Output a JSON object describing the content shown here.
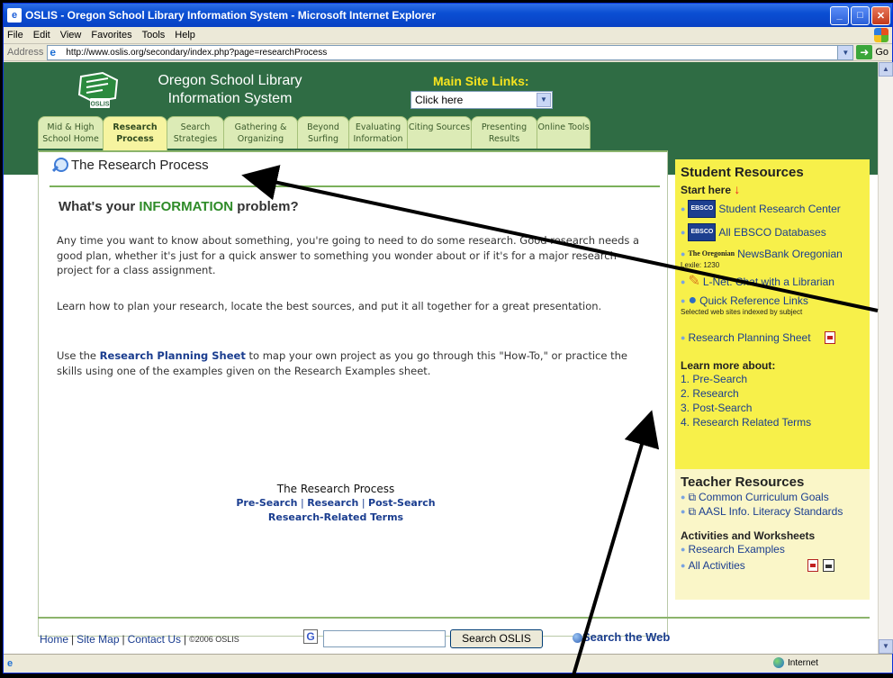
{
  "window": {
    "title": "OSLIS - Oregon School Library Information System - Microsoft Internet Explorer",
    "menus": [
      "File",
      "Edit",
      "View",
      "Favorites",
      "Tools",
      "Help"
    ],
    "address_label": "Address",
    "url": "http://www.oslis.org/secondary/index.php?page=researchProcess",
    "go_label": "Go"
  },
  "site": {
    "logo_text": "OSLIS",
    "title": "Oregon School Library Information System",
    "main_links_title": "Main Site Links:",
    "main_links_select": "Click here"
  },
  "tabs": [
    {
      "label": "Mid & High School Home",
      "active": false
    },
    {
      "label": "Research Process",
      "active": true
    },
    {
      "label": "Search Strategies",
      "active": false
    },
    {
      "label": "Gathering & Organizing",
      "active": false
    },
    {
      "label": "Beyond Surfing",
      "active": false
    },
    {
      "label": "Evaluating Information",
      "active": false
    },
    {
      "label": "Citing Sources",
      "active": false
    },
    {
      "label": "Presenting Results",
      "active": false
    },
    {
      "label": "Online Tools",
      "active": false
    }
  ],
  "content": {
    "page_title": "The Research Process",
    "heading_pre": "What's your ",
    "heading_hl": "INFORMATION",
    "heading_post": " problem?",
    "p1": "Any time you want to know about something, you're going to need to do some research. Good research needs a good plan, whether it's just for a quick answer to something you wonder about or if it's for a major research project for a class assignment.",
    "p2": "Learn how to plan your research, locate the best sources, and put it all together for a great presentation.",
    "p3_pre": "Use the ",
    "p3_link": "Research Planning Sheet",
    "p3_post": " to map your own project as you go through this \"How-To,\" or practice the skills using one of the examples given on the Research Examples sheet.",
    "rp_title": "The Research Process",
    "rp_links": [
      "Pre-Search",
      "Research",
      "Post-Search"
    ],
    "rp_sep": "|",
    "rp_terms": "Research-Related Terms"
  },
  "student": {
    "heading": "Student Resources",
    "start_here": "Start here",
    "ebsco_badge": "EBSCO",
    "src": "Student Research Center",
    "all_ebsco": "All EBSCO Databases",
    "newsbank_logo": "The Oregonian",
    "newsbank": "NewsBank Oregonian",
    "lexile": "Lexile: 1230",
    "lnet": "L-Net: Chat with a Librarian",
    "quick_ref": "Quick Reference Links",
    "quick_ref_sub": "Selected web sites indexed by subject",
    "planning": "Research Planning Sheet",
    "learn_more": "Learn more about:",
    "learn_items": [
      "1. Pre-Search",
      "2. Research",
      "3. Post-Search",
      "4. Research Related Terms"
    ]
  },
  "teacher": {
    "heading": "Teacher Resources",
    "links": [
      "Common Curriculum Goals",
      "AASL Info. Literacy Standards"
    ],
    "activities_heading": "Activities and Worksheets",
    "research_examples": "Research Examples",
    "all_activities": "All Activities"
  },
  "footer": {
    "home": "Home",
    "sitemap": "Site Map",
    "contact": "Contact Us",
    "sep": "|",
    "copyright": "©2006 OSLIS",
    "search_btn": "Search OSLIS",
    "search_web": "Search the Web"
  },
  "status": {
    "zone": "Internet"
  }
}
